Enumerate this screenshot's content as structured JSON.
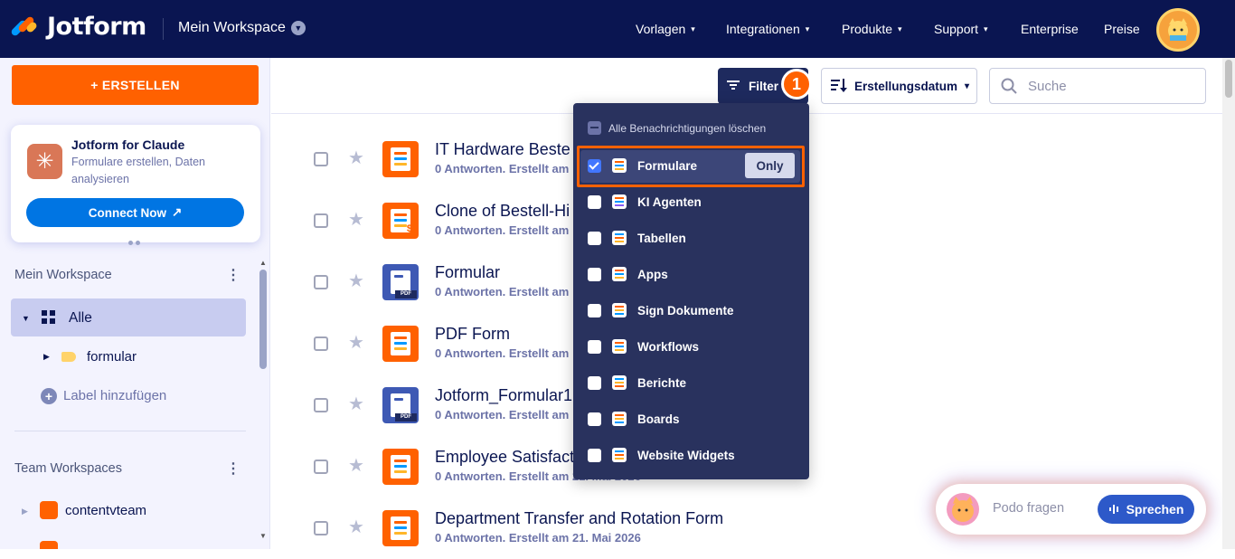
{
  "app": {
    "name": "Jotform",
    "workspace_switcher": "Mein Workspace"
  },
  "nav": [
    {
      "label": "Vorlagen",
      "has_menu": true
    },
    {
      "label": "Integrationen",
      "has_menu": true
    },
    {
      "label": "Produkte",
      "has_menu": true
    },
    {
      "label": "Support",
      "has_menu": true
    },
    {
      "label": "Enterprise",
      "has_menu": false
    },
    {
      "label": "Preise",
      "has_menu": false
    }
  ],
  "sidebar": {
    "create_label": "+ ERSTELLEN",
    "claude_card": {
      "title": "Jotform for Claude",
      "subtitle": "Formulare erstellen, Daten analysieren",
      "connect_label": "Connect Now",
      "connect_icon": "external-arrow-icon"
    },
    "my_workspace_title": "Mein Workspace",
    "all_label": "Alle",
    "folder_label": "formular",
    "add_label": "Label hinzufügen",
    "team_workspaces_title": "Team Workspaces",
    "team_item": "contentvteam"
  },
  "toolbar": {
    "filter_label": "Filter",
    "step_badge": "1",
    "sort_label": "Erstellungsdatum",
    "search_placeholder": "Suche"
  },
  "forms": [
    {
      "title": "IT Hardware Beste",
      "meta": "0 Antworten. Erstellt am",
      "icon": "form-icon",
      "color": "#ff6100"
    },
    {
      "title": "Clone of Bestell-Hi",
      "meta": "0 Antworten. Erstellt am",
      "icon": "payment-form-icon",
      "color": "#ff6100"
    },
    {
      "title": "Formular",
      "meta": "0 Antworten. Erstellt am",
      "icon": "pdf-form-icon",
      "color": "#3e59b4"
    },
    {
      "title": "PDF Form",
      "meta": "0 Antworten. Erstellt am",
      "icon": "form-icon",
      "color": "#ff6100"
    },
    {
      "title": "Jotform_Formular1",
      "meta": "0 Antworten. Erstellt am",
      "icon": "pdf-form-icon",
      "color": "#3e59b4"
    },
    {
      "title": "Employee Satisfact",
      "meta": "0 Antworten. Erstellt am 21. Mai 2026",
      "icon": "form-icon",
      "color": "#ff6100"
    },
    {
      "title": "Department Transfer and Rotation Form",
      "meta": "0 Antworten. Erstellt am 21. Mai 2026",
      "icon": "form-icon",
      "color": "#ff6100"
    }
  ],
  "filter_menu": {
    "clear_label": "Alle Benachrichtigungen löschen",
    "only_label": "Only",
    "items": [
      {
        "label": "Formulare",
        "checked": true,
        "icon": "forms-icon"
      },
      {
        "label": "KI Agenten",
        "checked": false,
        "icon": "ai-agents-icon"
      },
      {
        "label": "Tabellen",
        "checked": false,
        "icon": "tables-icon"
      },
      {
        "label": "Apps",
        "checked": false,
        "icon": "apps-icon"
      },
      {
        "label": "Sign Dokumente",
        "checked": false,
        "icon": "sign-icon"
      },
      {
        "label": "Workflows",
        "checked": false,
        "icon": "workflows-icon"
      },
      {
        "label": "Berichte",
        "checked": false,
        "icon": "reports-icon"
      },
      {
        "label": "Boards",
        "checked": false,
        "icon": "boards-icon"
      },
      {
        "label": "Website Widgets",
        "checked": false,
        "icon": "widgets-icon"
      }
    ]
  },
  "assistant": {
    "placeholder": "Podo fragen",
    "speak_label": "Sprechen"
  },
  "colors": {
    "navy": "#0a1551",
    "orange": "#ff6100",
    "blue": "#0075e3",
    "menu_bg": "#29325e"
  }
}
